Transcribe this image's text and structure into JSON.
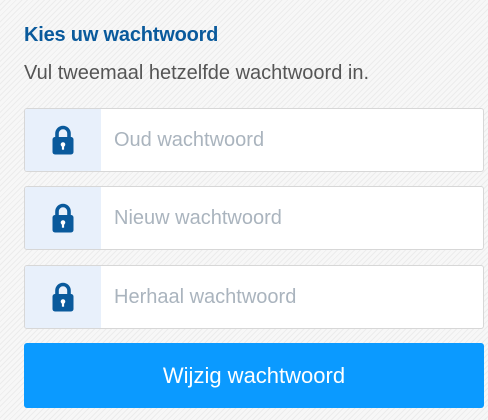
{
  "form": {
    "title": "Kies uw wachtwoord",
    "subtitle": "Vul tweemaal hetzelfde wachtwoord in.",
    "fields": [
      {
        "icon": "lock-icon",
        "placeholder": "Oud wachtwoord",
        "value": ""
      },
      {
        "icon": "lock-icon",
        "placeholder": "Nieuw wachtwoord",
        "value": ""
      },
      {
        "icon": "lock-icon",
        "placeholder": "Herhaal wachtwoord",
        "value": ""
      }
    ],
    "submit_label": "Wijzig wachtwoord"
  },
  "colors": {
    "title": "#0a5a9c",
    "icon": "#0a5a9c",
    "icon_background": "#e8f0fb",
    "button": "#0b9aff",
    "placeholder": "#aab4be"
  }
}
